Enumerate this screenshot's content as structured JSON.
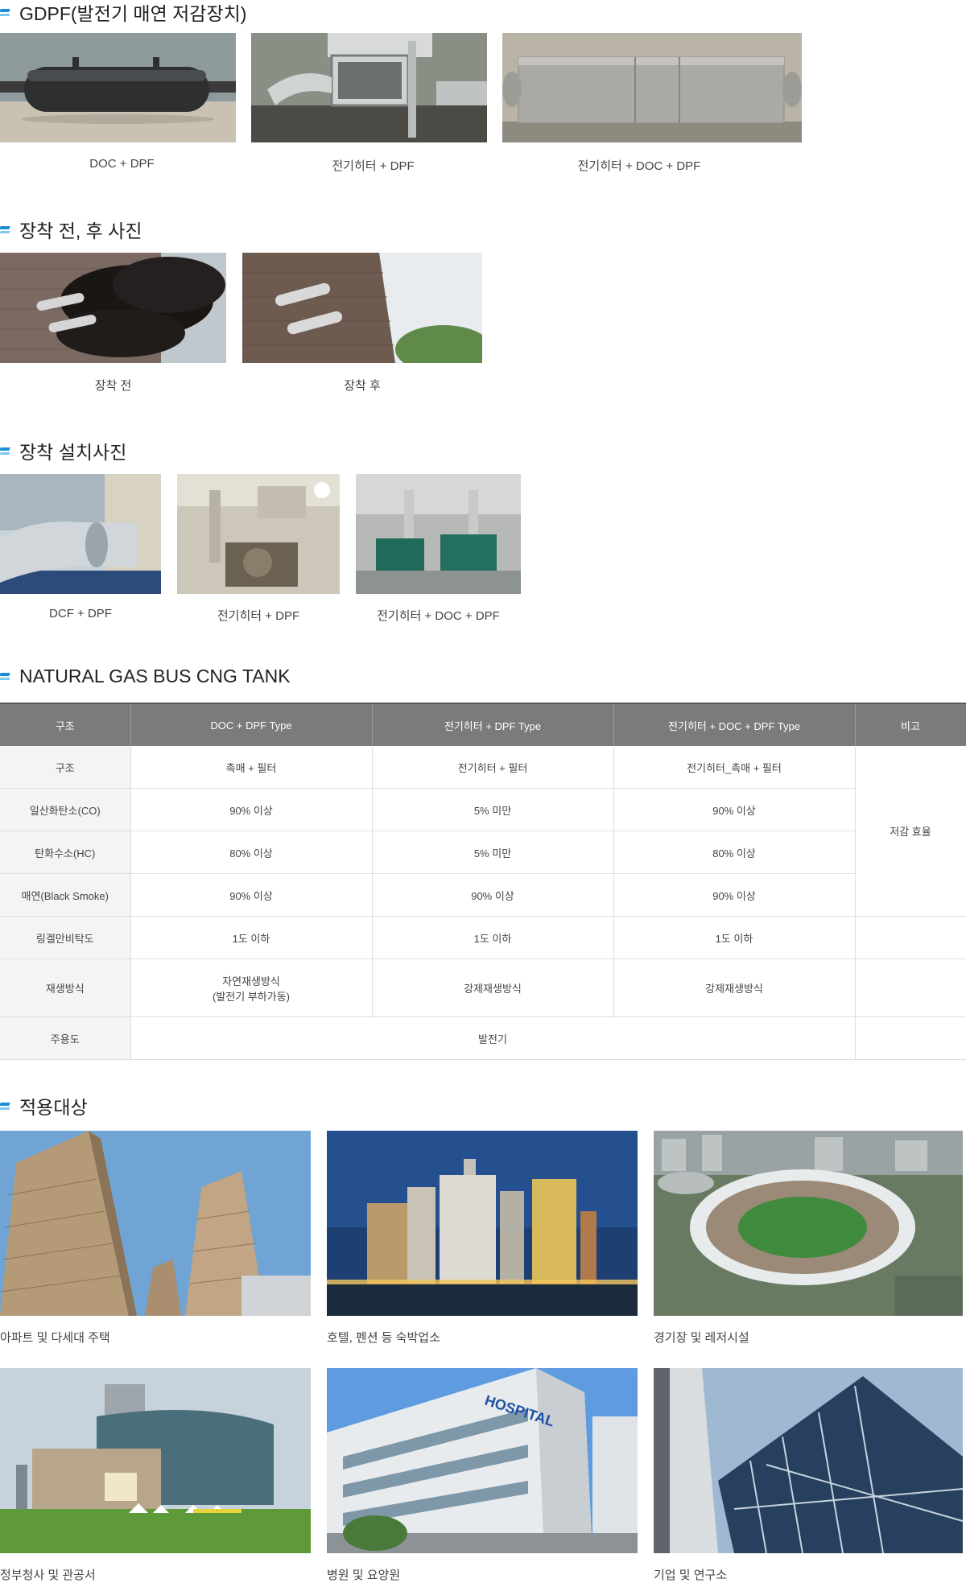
{
  "sections": {
    "gdpf": {
      "title": "GDPF(발전기 매연 저감장치)",
      "items": [
        {
          "caption": "DOC + DPF",
          "image": "black-muffler-photo"
        },
        {
          "caption": "전기히터 + DPF",
          "image": "heater-dpf-frame-photo"
        },
        {
          "caption": "전기히터 + DOC + DPF",
          "image": "steel-box-photo"
        }
      ]
    },
    "before_after": {
      "title": "장착 전, 후 사진",
      "items": [
        {
          "caption": "장착 전",
          "image": "black-smoke-exhaust-photo"
        },
        {
          "caption": "장착 후",
          "image": "clean-exhaust-photo"
        }
      ]
    },
    "install": {
      "title": "장착 설치사진",
      "items": [
        {
          "caption": "DCF + DPF",
          "image": "outdoor-duct-photo"
        },
        {
          "caption": "전기히터 + DPF",
          "image": "generator-room-photo"
        },
        {
          "caption": "전기히터 + DOC + DPF",
          "image": "green-generators-photo"
        }
      ]
    },
    "table": {
      "title": "NATURAL GAS BUS CNG TANK",
      "headers": [
        "구조",
        "DOC + DPF Type",
        "전기히터 + DPF Type",
        "전기히터 + DOC + DPF Type",
        "비고"
      ],
      "rows": [
        [
          "구조",
          "촉매 + 필터",
          "전기히터 + 필터",
          "전기히터_촉매 + 필터"
        ],
        [
          "일산화탄소(CO)",
          "90% 이상",
          "5% 미만",
          "90% 이상"
        ],
        [
          "탄화수소(HC)",
          "80% 이상",
          "5% 미만",
          "80% 이상"
        ],
        [
          "매연(Black Smoke)",
          "90% 이상",
          "90% 이상",
          "90% 이상"
        ],
        [
          "링겔만비탁도",
          "1도 이하",
          "1도 이하",
          "1도 이하"
        ],
        [
          "재생방식",
          "자연재생방식\n(발전기 부하가동)",
          "강제재생방식",
          "강제재생방식"
        ],
        [
          "주용도",
          "발전기"
        ]
      ],
      "note": "저감 효율"
    },
    "targets": {
      "title": "적용대상",
      "items": [
        {
          "caption": "아파트 및 다세대 주택",
          "image": "apartment-towers-photo"
        },
        {
          "caption": "호텔, 펜션 등 숙박업소",
          "image": "hotel-skyline-photo"
        },
        {
          "caption": "경기장 및 레저시설",
          "image": "stadium-aerial-photo"
        },
        {
          "caption": "정부청사 및 관공서",
          "image": "city-hall-photo"
        },
        {
          "caption": "병원 및 요양원",
          "image": "hospital-building-photo"
        },
        {
          "caption": "기업 및 연구소",
          "image": "glass-office-photo"
        }
      ],
      "sign_text": "HOSPITAL"
    }
  },
  "colors": {
    "accent": "#1a8fd6",
    "accent_light": "#7ccaf2",
    "table_header": "#7b7b7b",
    "row_header_bg": "#f4f4f4"
  }
}
